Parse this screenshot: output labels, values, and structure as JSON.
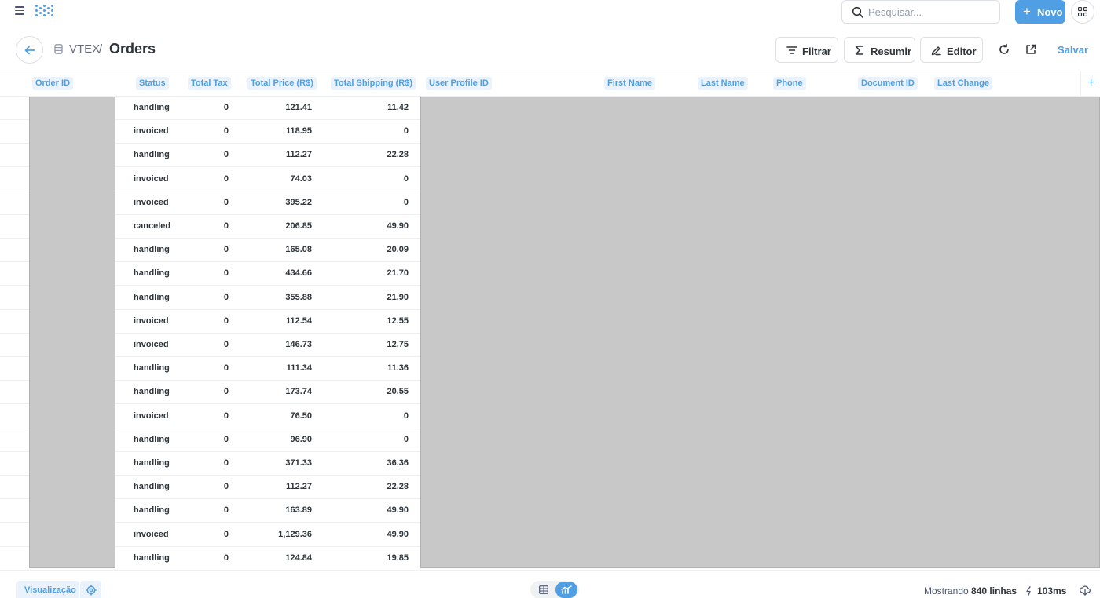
{
  "topbar": {
    "search_placeholder": "Pesquisar...",
    "new_label": "Novo"
  },
  "header": {
    "database": "VTEX",
    "separator": "/",
    "title": "Orders",
    "filter_label": "Filtrar",
    "summarize_label": "Resumir",
    "editor_label": "Editor",
    "save_label": "Salvar"
  },
  "table": {
    "columns": [
      "Order ID",
      "Status",
      "Total Tax",
      "Total Price (R$)",
      "Total Shipping (R$)",
      "User Profile ID",
      "First Name",
      "Last Name",
      "Phone",
      "Document ID",
      "Last Change"
    ],
    "rows": [
      {
        "status": "handling",
        "tax": "0",
        "price": "121.41",
        "shipping": "11.42"
      },
      {
        "status": "invoiced",
        "tax": "0",
        "price": "118.95",
        "shipping": "0"
      },
      {
        "status": "handling",
        "tax": "0",
        "price": "112.27",
        "shipping": "22.28"
      },
      {
        "status": "invoiced",
        "tax": "0",
        "price": "74.03",
        "shipping": "0"
      },
      {
        "status": "invoiced",
        "tax": "0",
        "price": "395.22",
        "shipping": "0"
      },
      {
        "status": "canceled",
        "tax": "0",
        "price": "206.85",
        "shipping": "49.90"
      },
      {
        "status": "handling",
        "tax": "0",
        "price": "165.08",
        "shipping": "20.09"
      },
      {
        "status": "handling",
        "tax": "0",
        "price": "434.66",
        "shipping": "21.70"
      },
      {
        "status": "handling",
        "tax": "0",
        "price": "355.88",
        "shipping": "21.90"
      },
      {
        "status": "invoiced",
        "tax": "0",
        "price": "112.54",
        "shipping": "12.55"
      },
      {
        "status": "invoiced",
        "tax": "0",
        "price": "146.73",
        "shipping": "12.75"
      },
      {
        "status": "handling",
        "tax": "0",
        "price": "111.34",
        "shipping": "11.36"
      },
      {
        "status": "handling",
        "tax": "0",
        "price": "173.74",
        "shipping": "20.55"
      },
      {
        "status": "invoiced",
        "tax": "0",
        "price": "76.50",
        "shipping": "0"
      },
      {
        "status": "handling",
        "tax": "0",
        "price": "96.90",
        "shipping": "0"
      },
      {
        "status": "handling",
        "tax": "0",
        "price": "371.33",
        "shipping": "36.36"
      },
      {
        "status": "handling",
        "tax": "0",
        "price": "112.27",
        "shipping": "22.28"
      },
      {
        "status": "handling",
        "tax": "0",
        "price": "163.89",
        "shipping": "49.90"
      },
      {
        "status": "invoiced",
        "tax": "0",
        "price": "1,129.36",
        "shipping": "49.90"
      },
      {
        "status": "handling",
        "tax": "0",
        "price": "124.84",
        "shipping": "19.85"
      }
    ]
  },
  "footer": {
    "visualization_label": "Visualização",
    "row_count_prefix": "Mostrando",
    "row_count_value": "840 linhas",
    "timing": "103ms"
  },
  "colors": {
    "accent": "#509ee3",
    "accent_light": "#eaf3fb",
    "text_dark": "#2e353b",
    "text_medium": "#4c5773",
    "border": "#dcdfe4",
    "redaction": "#c8c8c8"
  },
  "icons": [
    "hamburger-icon",
    "logo-icon",
    "search-icon",
    "plus-icon",
    "grid-apps-icon",
    "back-arrow-icon",
    "database-icon",
    "filter-icon",
    "sigma-icon",
    "pencil-icon",
    "refresh-icon",
    "external-link-icon",
    "add-column-icon",
    "gear-icon",
    "table-icon",
    "chart-icon",
    "bolt-icon",
    "download-icon"
  ]
}
